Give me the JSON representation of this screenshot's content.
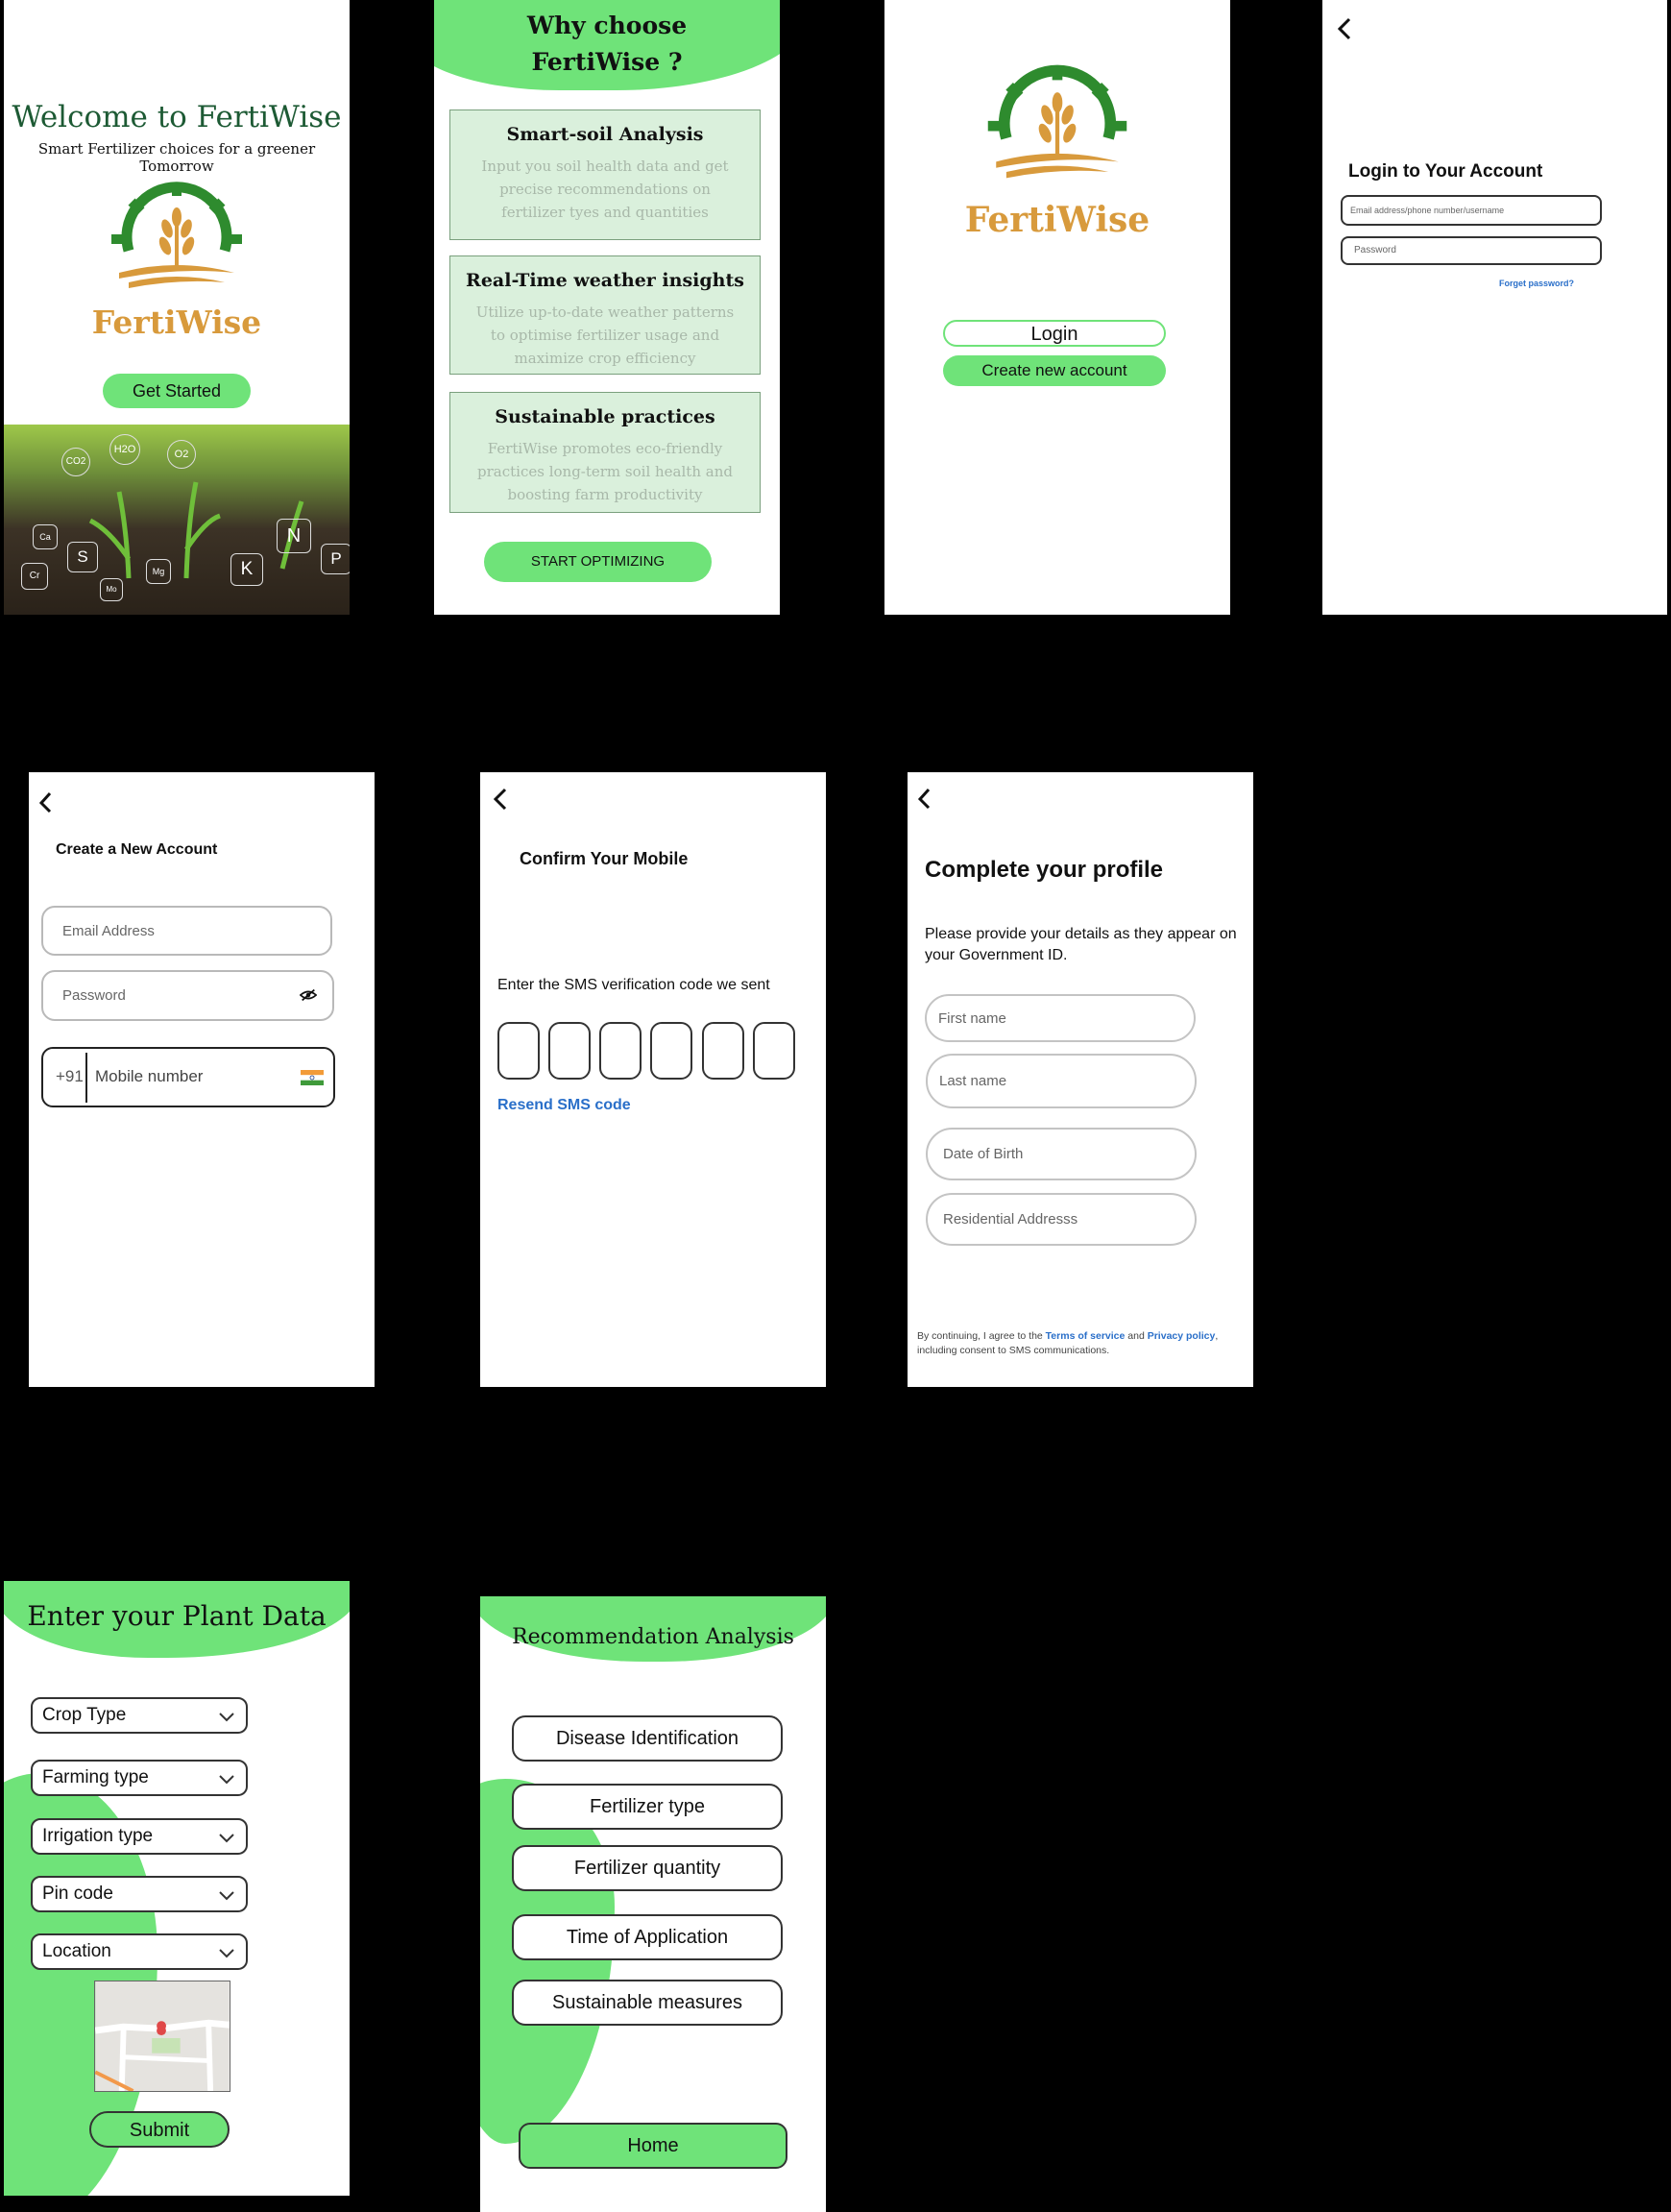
{
  "welcome": {
    "title": "Welcome to FertiWise",
    "subtitle": "Smart Fertilizer choices for a greener Tomorrow",
    "brand": "FertiWise",
    "get_started": "Get Started",
    "chem_labels": [
      "H2O",
      "CO2",
      "O2",
      "Ca",
      "S",
      "Cr",
      "Mg",
      "Mo",
      "K",
      "N",
      "P"
    ]
  },
  "why": {
    "title_line1": "Why choose",
    "title_line2": "FertiWise ?",
    "features": [
      {
        "title": "Smart-soil Analysis",
        "text": "Input you soil health data and get precise recommendations on fertilizer tyes and quantities"
      },
      {
        "title": "Real-Time weather insights",
        "text": "Utilize up-to-date weather patterns to optimise fertilizer usage and maximize crop efficiency"
      },
      {
        "title": "Sustainable practices",
        "text": "FertiWise promotes eco-friendly practices long-term soil health and boosting farm productivity"
      }
    ],
    "cta": "START OPTIMIZING"
  },
  "landing": {
    "brand": "FertiWise",
    "login": "Login",
    "create": "Create new account"
  },
  "login": {
    "title": "Login to Your Account",
    "id_placeholder": "Email address/phone number/username",
    "password_placeholder": "Password",
    "forgot": "Forget password?"
  },
  "create_account": {
    "title": "Create a New Account",
    "email": "Email Address",
    "password": "Password",
    "country_code": "+91",
    "mobile": "Mobile number"
  },
  "confirm": {
    "title": "Confirm Your Mobile",
    "instruction": "Enter the SMS verification code we sent",
    "resend": "Resend SMS code"
  },
  "profile": {
    "title": "Complete your profile",
    "instruction": "Please provide your details as they appear on your Government ID.",
    "first": "First name",
    "last": "Last name",
    "dob": "Date of Birth",
    "address": "Residential Addresss",
    "legal_pre": "By continuing, I agree to the ",
    "terms": "Terms of service",
    "legal_and": " and ",
    "privacy": "Privacy policy",
    "legal_post": ", including consent to SMS communications."
  },
  "plant": {
    "title": "Enter your Plant Data",
    "fields": [
      "Crop Type",
      "Farming type",
      "Irrigation type",
      "Pin code",
      "Location"
    ],
    "submit": "Submit"
  },
  "recommend": {
    "title": "Recommendation Analysis",
    "items": [
      "Disease Identification",
      "Fertilizer type",
      "Fertilizer quantity",
      "Time of Application",
      "Sustainable measures"
    ],
    "home": "Home"
  },
  "colors": {
    "accent_green": "#6fe379",
    "brand_orange": "#d89a3c",
    "brand_green": "#2e8b2e",
    "link_blue": "#2a6fc9",
    "title_green": "#1d5a34"
  }
}
